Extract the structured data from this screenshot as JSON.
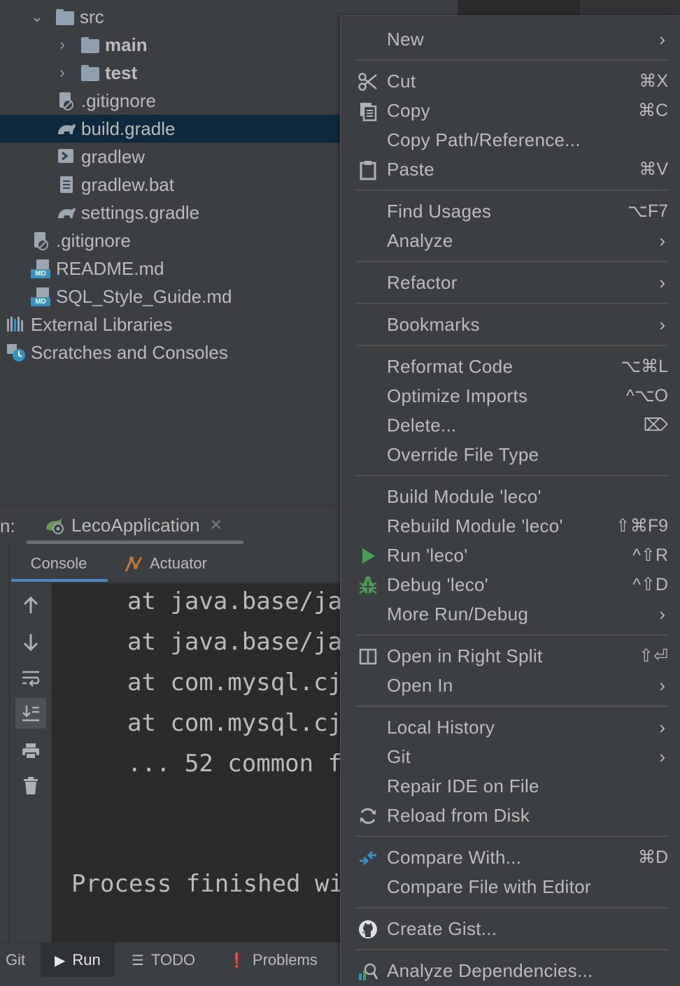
{
  "project_tree": {
    "items": [
      {
        "label": "src",
        "type": "folder",
        "expanded": true,
        "bold": false
      },
      {
        "label": "main",
        "type": "folder",
        "expanded": false,
        "bold": true
      },
      {
        "label": "test",
        "type": "folder",
        "expanded": false,
        "bold": true
      },
      {
        "label": ".gitignore",
        "type": "gitignore"
      },
      {
        "label": "build.gradle",
        "type": "gradle",
        "selected": true
      },
      {
        "label": "gradlew",
        "type": "shell"
      },
      {
        "label": "gradlew.bat",
        "type": "doc"
      },
      {
        "label": "settings.gradle",
        "type": "gradle"
      },
      {
        "label": ".gitignore",
        "type": "gitignore"
      },
      {
        "label": "README.md",
        "type": "markdown"
      },
      {
        "label": "SQL_Style_Guide.md",
        "type": "markdown"
      },
      {
        "label": "External Libraries",
        "type": "libraries"
      },
      {
        "label": "Scratches and Consoles",
        "type": "scratches"
      }
    ]
  },
  "run_window": {
    "label": "n:",
    "config_tab": "LecoApplication",
    "tabs": {
      "console": "Console",
      "actuator": "Actuator"
    },
    "console_lines": [
      "at java.base/ja",
      "at java.base/ja",
      "at com.mysql.cj",
      "at com.mysql.cj",
      "... 52 common f",
      "Process finished wi"
    ]
  },
  "bottom_bar": {
    "git": "Git",
    "run": "Run",
    "todo": "TODO",
    "problems": "Problems"
  },
  "context_menu": {
    "new": {
      "label": "New"
    },
    "cut": {
      "label": "Cut",
      "shortcut": "⌘X"
    },
    "copy": {
      "label": "Copy",
      "shortcut": "⌘C"
    },
    "copy_path": {
      "label": "Copy Path/Reference..."
    },
    "paste": {
      "label": "Paste",
      "shortcut": "⌘V"
    },
    "find_usages": {
      "label": "Find Usages",
      "shortcut": "⌥F7"
    },
    "analyze": {
      "label": "Analyze"
    },
    "refactor": {
      "label": "Refactor"
    },
    "bookmarks": {
      "label": "Bookmarks"
    },
    "reformat": {
      "label": "Reformat Code",
      "shortcut": "⌥⌘L"
    },
    "optimize": {
      "label": "Optimize Imports",
      "shortcut": "^⌥O"
    },
    "delete": {
      "label": "Delete...",
      "shortcut": "⌦"
    },
    "override": {
      "label": "Override File Type"
    },
    "build_module": {
      "label": "Build Module 'leco'"
    },
    "rebuild_module": {
      "label": "Rebuild Module 'leco'",
      "shortcut": "⇧⌘F9"
    },
    "run": {
      "label": "Run 'leco'",
      "shortcut": "^⇧R"
    },
    "debug": {
      "label": "Debug 'leco'",
      "shortcut": "^⇧D"
    },
    "more_run": {
      "label": "More Run/Debug"
    },
    "open_right": {
      "label": "Open in Right Split",
      "shortcut": "⇧⏎"
    },
    "open_in": {
      "label": "Open In"
    },
    "local_history": {
      "label": "Local History"
    },
    "git": {
      "label": "Git"
    },
    "repair": {
      "label": "Repair IDE on File"
    },
    "reload": {
      "label": "Reload from Disk"
    },
    "compare_with": {
      "label": "Compare With...",
      "shortcut": "⌘D"
    },
    "compare_editor": {
      "label": "Compare File with Editor"
    },
    "create_gist": {
      "label": "Create Gist..."
    },
    "analyze_deps": {
      "label": "Analyze Dependencies..."
    },
    "submenu_arrow": "›"
  },
  "colors": {
    "background": "#3c3f41",
    "selection": "#0d293e",
    "console_bg": "#2b2b2b",
    "run_green": "#499c54",
    "accent_blue": "#4a88c7"
  }
}
